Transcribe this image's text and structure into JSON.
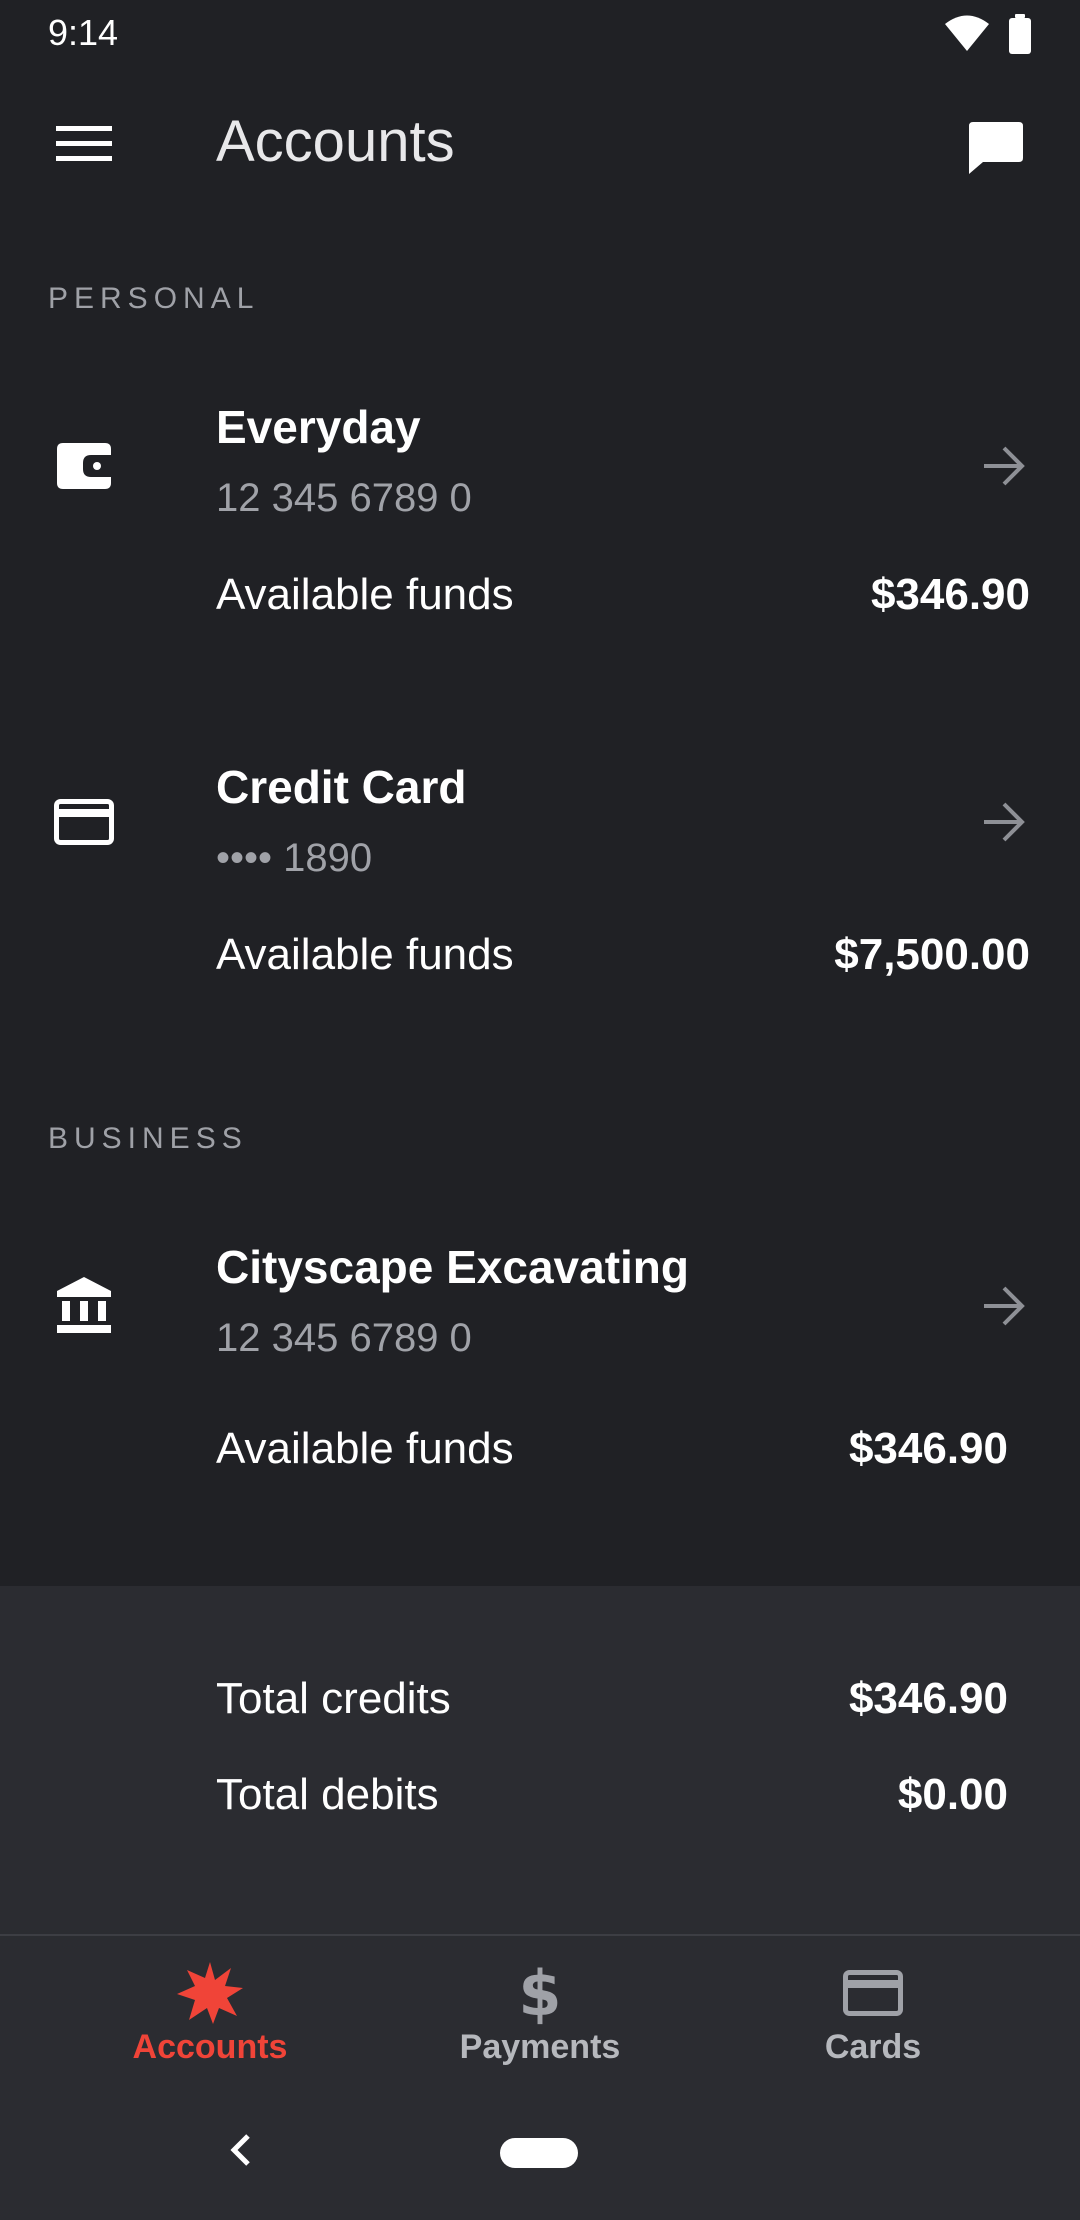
{
  "status_bar": {
    "time": "9:14"
  },
  "app_bar": {
    "title": "Accounts"
  },
  "sections": {
    "personal": "PERSONAL",
    "business": "BUSINESS"
  },
  "accounts": [
    {
      "name": "Everyday",
      "number": "12 345 6789 0",
      "funds_label": "Available funds",
      "funds_value": "$346.90",
      "icon": "wallet-icon"
    },
    {
      "name": "Credit Card",
      "number": "•••• 1890",
      "funds_label": "Available funds",
      "funds_value": "$7,500.00",
      "icon": "credit-card-icon"
    },
    {
      "name": "Cityscape Excavating",
      "number": "12 345 6789 0",
      "funds_label": "Available funds",
      "funds_value": "$346.90",
      "icon": "bank-icon"
    }
  ],
  "totals": {
    "credits_label": "Total credits",
    "credits_value": "$346.90",
    "debits_label": "Total debits",
    "debits_value": "$0.00"
  },
  "bottom_nav": [
    {
      "label": "Accounts",
      "icon": "star-logo-icon",
      "active": true
    },
    {
      "label": "Payments",
      "icon": "dollar-icon",
      "active": false
    },
    {
      "label": "Cards",
      "icon": "card-icon",
      "active": false
    }
  ],
  "colors": {
    "background": "#202125",
    "surface": "#2b2c31",
    "accent": "#f04438",
    "muted": "#a0a2a8"
  }
}
